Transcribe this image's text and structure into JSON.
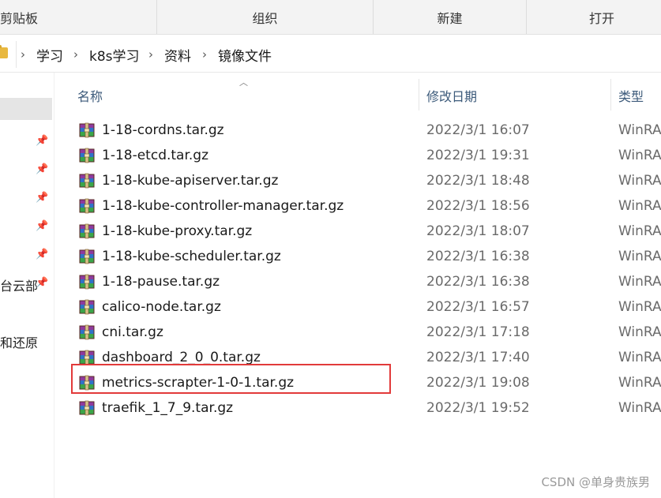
{
  "ribbon": {
    "groups": [
      "剪贴板",
      "组织",
      "新建",
      "打开"
    ]
  },
  "address": {
    "crumbs": [
      "学习",
      "k8s学习",
      "资料",
      "镜像文件"
    ]
  },
  "nav": {
    "partial_items": [
      "台云部",
      "和还原"
    ]
  },
  "columns": {
    "name": "名称",
    "date": "修改日期",
    "type": "类型"
  },
  "files": [
    {
      "name": "1-18-cordns.tar.gz",
      "date": "2022/3/1 16:07",
      "type": "WinRA"
    },
    {
      "name": "1-18-etcd.tar.gz",
      "date": "2022/3/1 19:31",
      "type": "WinRA"
    },
    {
      "name": "1-18-kube-apiserver.tar.gz",
      "date": "2022/3/1 18:48",
      "type": "WinRA"
    },
    {
      "name": "1-18-kube-controller-manager.tar.gz",
      "date": "2022/3/1 18:56",
      "type": "WinRA"
    },
    {
      "name": "1-18-kube-proxy.tar.gz",
      "date": "2022/3/1 18:07",
      "type": "WinRA"
    },
    {
      "name": "1-18-kube-scheduler.tar.gz",
      "date": "2022/3/1 16:38",
      "type": "WinRA"
    },
    {
      "name": "1-18-pause.tar.gz",
      "date": "2022/3/1 16:38",
      "type": "WinRA"
    },
    {
      "name": "calico-node.tar.gz",
      "date": "2022/3/1 16:57",
      "type": "WinRA"
    },
    {
      "name": "cni.tar.gz",
      "date": "2022/3/1 17:18",
      "type": "WinRA"
    },
    {
      "name": "dashboard_2_0_0.tar.gz",
      "date": "2022/3/1 17:40",
      "type": "WinRA"
    },
    {
      "name": "metrics-scrapter-1-0-1.tar.gz",
      "date": "2022/3/1 19:08",
      "type": "WinRA"
    },
    {
      "name": "traefik_1_7_9.tar.gz",
      "date": "2022/3/1 19:52",
      "type": "WinRA"
    }
  ],
  "watermark": "CSDN @单身贵族男",
  "colors": {
    "highlight": "#e23a3a",
    "header_text": "#3c5a7a"
  },
  "icons": {
    "file": "winrar-archive-icon",
    "pin": "pin-icon",
    "folder": "folder-icon"
  }
}
